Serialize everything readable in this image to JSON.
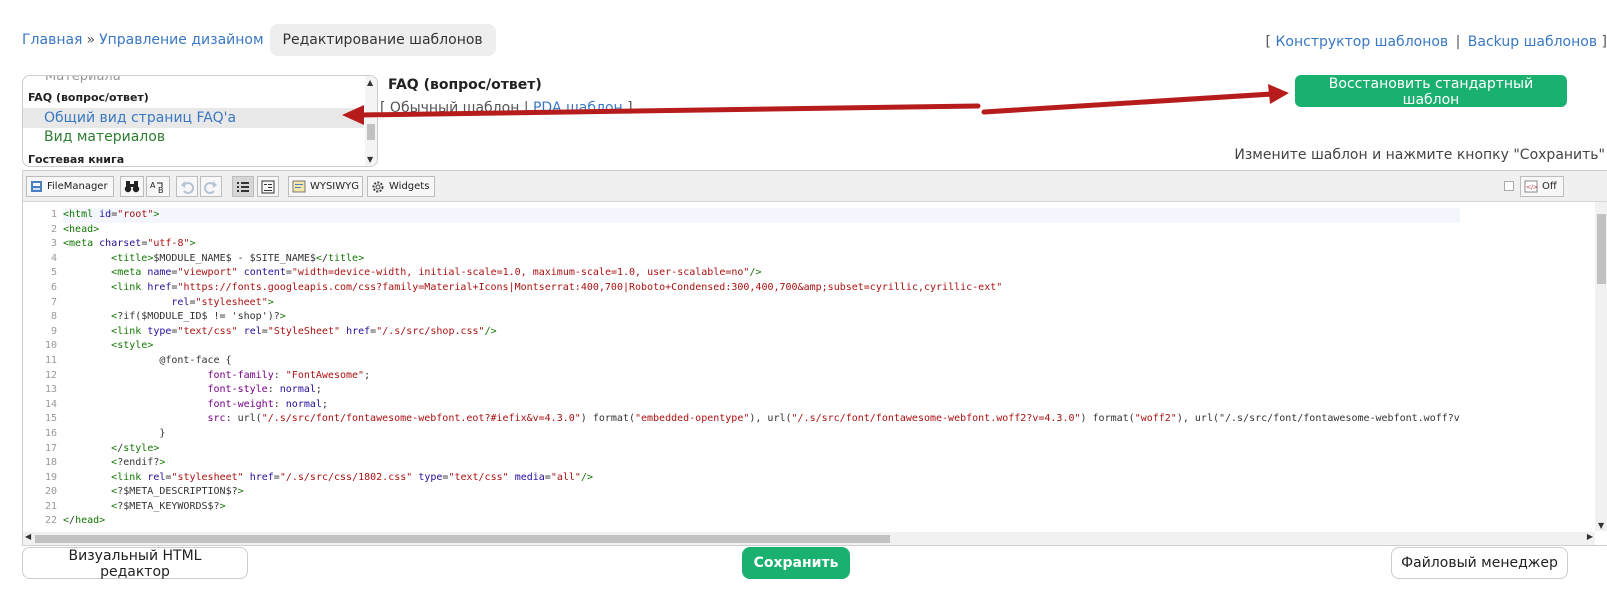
{
  "breadcrumb": {
    "home": "Главная",
    "separator": "»",
    "design": "Управление дизайном",
    "current": "Редактирование шаблонов"
  },
  "top_links": {
    "open": "[",
    "constructor": "Конструктор шаблонов",
    "divider": "|",
    "backup": "Backup шаблонов",
    "close": "]"
  },
  "template_list": {
    "faded_item": "Материала",
    "group1": "FAQ (вопрос/ответ)",
    "item_selected": "Общий вид страниц FAQ'а",
    "item_materials": "Вид материалов",
    "group2": "Гостевая книга"
  },
  "template_header": {
    "title": "FAQ (вопрос/ответ)",
    "open": "[",
    "normal": "Обычный шаблон",
    "divider": "|",
    "pda": "PDA шаблон",
    "close": "]"
  },
  "restore_button": "Восстановить стандартный шаблон",
  "hint": "Измените шаблон и нажмите кнопку \"Сохранить\"",
  "toolbar": {
    "file_manager": "FileManager",
    "wysiwyg": "WYSIWYG",
    "widgets": "Widgets",
    "off": "Off"
  },
  "code": {
    "line_numbers": [
      "1",
      "2",
      "3",
      "4",
      "5",
      "6",
      "7",
      "8",
      "9",
      "10",
      "11",
      "12",
      "13",
      "14",
      "15",
      "16",
      "17",
      "18",
      "19",
      "20",
      "21",
      "22"
    ],
    "lines": [
      "<html id=\"root\">",
      "<head>",
      "<meta charset=\"utf-8\">",
      "        <title>$MODULE_NAME$ - $SITE_NAME$</title>",
      "        <meta name=\"viewport\" content=\"width=device-width, initial-scale=1.0, maximum-scale=1.0, user-scalable=no\"/>",
      "        <link href=\"https://fonts.googleapis.com/css?family=Material+Icons|Montserrat:400,700|Roboto+Condensed:300,400,700&amp;subset=cyrillic,cyrillic-ext\"",
      "                  rel=\"stylesheet\">",
      "        <?if($MODULE_ID$ != 'shop')?>",
      "        <link type=\"text/css\" rel=\"StyleSheet\" href=\"/.s/src/shop.css\"/>",
      "        <style>",
      "                @font-face {",
      "                        font-family: \"FontAwesome\";",
      "                        font-style: normal;",
      "                        font-weight: normal;",
      "                        src: url(\"/.s/src/font/fontawesome-webfont.eot?#iefix&v=4.3.0\") format(\"embedded-opentype\"), url(\"/.s/src/font/fontawesome-webfont.woff2?v=4.3.0\") format(\"woff2\"), url(\"/.s/src/font/fontawesome-webfont.woff?v",
      "                }",
      "        </style>",
      "        <?endif?>",
      "        <link rel=\"stylesheet\" href=\"/.s/src/css/1802.css\" type=\"text/css\" media=\"all\"/>",
      "        <?$META_DESCRIPTION$?>",
      "        <?$META_KEYWORDS$?>",
      "</head>"
    ]
  },
  "bottom": {
    "visual_editor": "Визуальный HTML редактор",
    "save": "Сохранить",
    "file_manager": "Файловый менеджер"
  },
  "colors": {
    "accent_green": "#1ab06f",
    "link_blue": "#3a78c3",
    "arrow_red": "#b71c1c"
  }
}
